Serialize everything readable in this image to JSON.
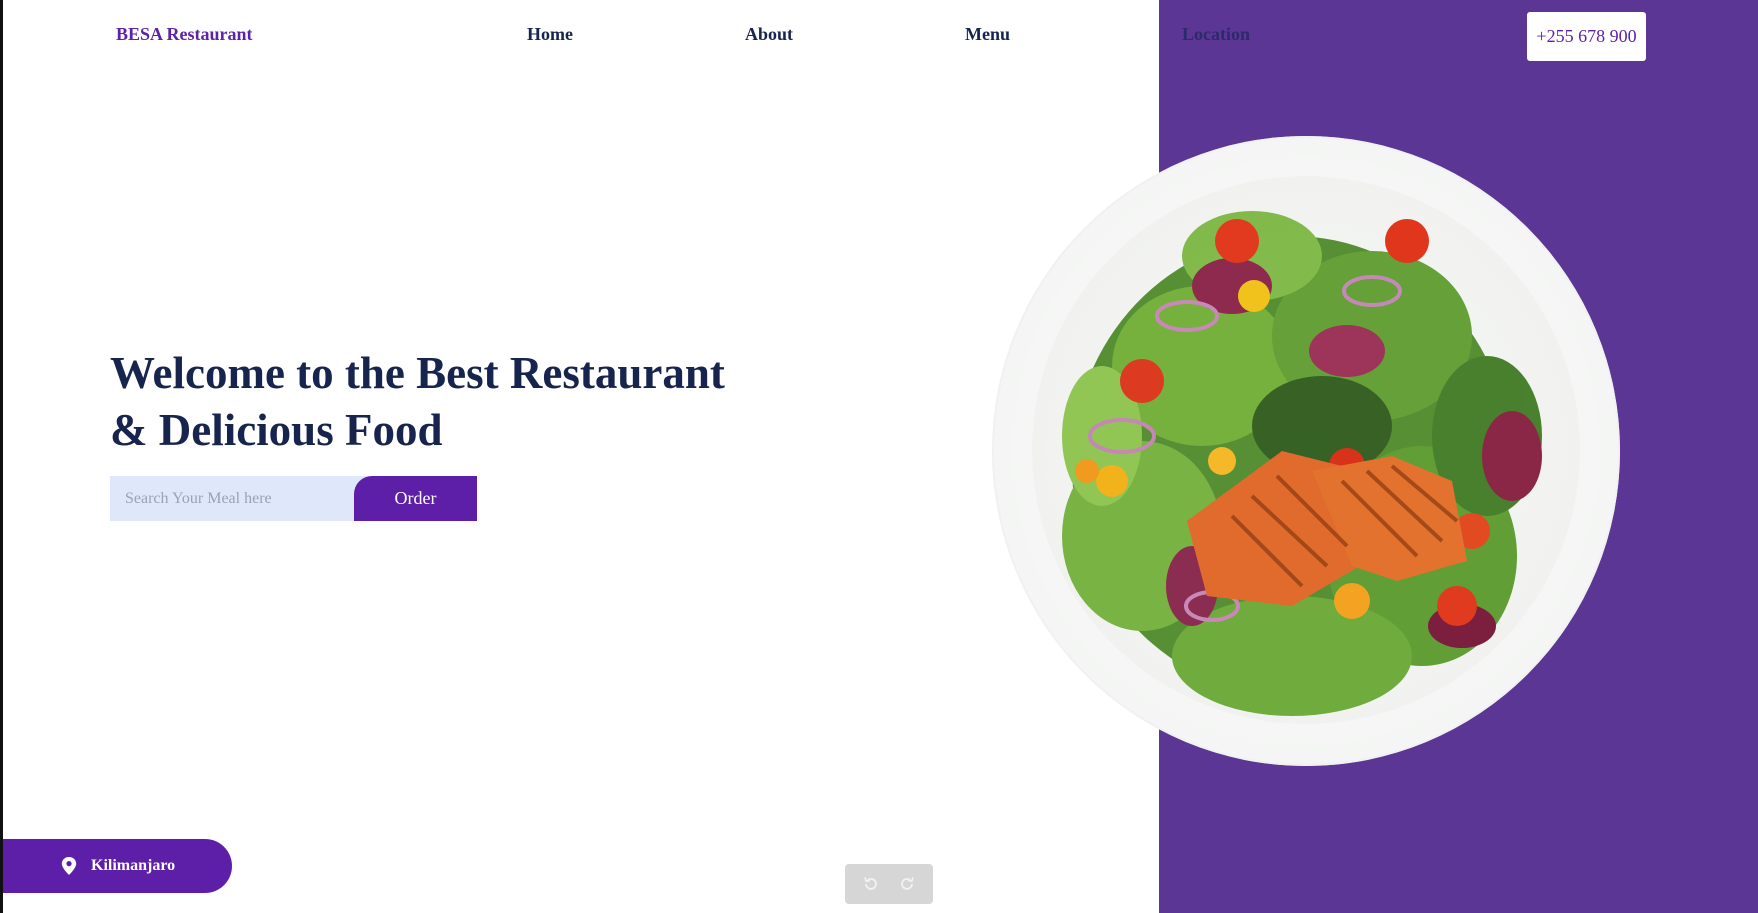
{
  "nav": {
    "brand": "BESA Restaurant",
    "links": [
      {
        "label": "Home"
      },
      {
        "label": "About"
      },
      {
        "label": "Menu"
      },
      {
        "label": "Location"
      }
    ],
    "phone": "+255 678 900"
  },
  "hero": {
    "title_line1": "Welcome to the Best Restaurant",
    "title_line2": "& Delicious Food",
    "search_placeholder": "Search Your Meal here",
    "order_label": "Order",
    "image_icon": "salmon-salad-plate"
  },
  "location_badge": {
    "icon": "map-pin-icon",
    "label": "Kilimanjaro"
  },
  "history_controls": {
    "undo_icon": "undo-icon",
    "redo_icon": "redo-icon"
  },
  "colors": {
    "brand_purple": "#5d22a8",
    "panel_purple": "#5b3695",
    "navy_text": "#17244e",
    "search_bg": "#dfe8fb"
  }
}
